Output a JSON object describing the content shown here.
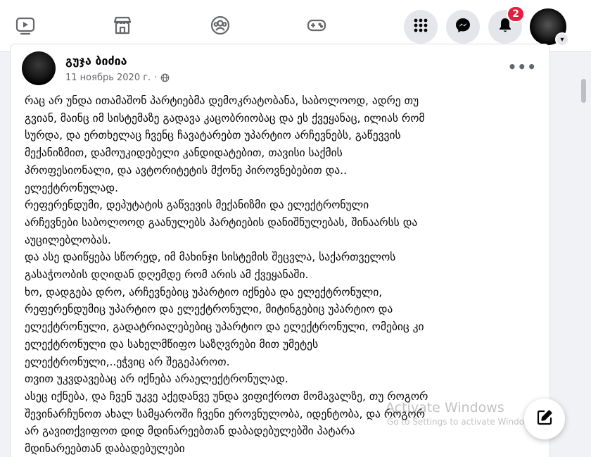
{
  "topbar": {
    "tabs": [
      {
        "icon": "watch-video-icon"
      },
      {
        "icon": "marketplace-icon"
      },
      {
        "icon": "groups-icon"
      },
      {
        "icon": "gaming-icon"
      }
    ],
    "menu_icon": "grid-menu-icon",
    "messenger_icon": "messenger-icon",
    "notifications_icon": "bell-icon",
    "notifications_count": "2",
    "profile_caret": "▾"
  },
  "post": {
    "author": "გუჯა ბიძია",
    "date": "11 ноябрь 2020 г.",
    "separator": "·",
    "privacy_icon": "globe-icon",
    "more_label": "•••",
    "lines": [
      "რაც არ უნდა ითამაშონ პარტიებმა დემოკრატობანა, საბოლოოდ, ადრე თუ",
      "გვიან, მაინც იმ სისტემაზე გადავა კაცობრიობაც და ეს ქვეყანაც, ილიას რომ",
      "სურდა, და ერთხელაც ჩვენც  ჩავატარებთ უპარტიო არჩევნებს, გაწევვის",
      "მექანიზმით, დამოუკიდებელი კანდიდატებით, თავისი საქმის",
      "პროფესიონალი, და ავტორიტეტის მქონე პიროვნებებით და..",
      "ელექტრონულად.",
      "რეფერენდუმი, დეპუტატის გაწვევის მექანიზმი და ელექტრონული",
      "არჩევნები საბოლოოდ გაანულებს პარტიების დანიშნულებას, შინაარსს და",
      "აუცილებლობას.",
      "და ასე დაიწყება სწორედ, იმ მახინჯი სისტემის შეცვლა, საქართველოს",
      "გასაჭოობის დღიდან დღემდე რომ არის ამ ქვეყანაში.",
      "ხო, დადგება დრო, არჩევნებიც უპარტიო იქნება და ელექტრონული,",
      "რეფერენდუმიც უპარტიო და ელექტრონული, მიტინგებიც უპარტიო და",
      "ელექტრონული, გადატრიალებებიც უპარტიო და ელექტრონული, ომებიც კი",
      "ელექტრონული და სახელმწიფო საზღვრები მით უმეტეს",
      "ელექტრონული,..ეჭვიც არ შეგეპაროთ.",
      "თვით უკვდავებაც არ იქნება არაელექტრონულად.",
      "ასეც იქნება, და ჩვენ უკვე აქედანვე უნდა ვიფიქროთ მომავალზე, თუ როგორ",
      "შევინარჩუნოთ ახალ სამყაროში ჩვენი ეროვნულობა, იდენტობა, და როგორ",
      "არ გავითქვიფოთ დიდ მდინარეებთან დაბადებულებში პატარა",
      "მდინარეებთან დაბადებულები"
    ]
  },
  "watermark": {
    "title": "Activate Windows",
    "subtitle": "Go to Settings to activate Windows."
  },
  "compose_icon": "new-message-icon"
}
